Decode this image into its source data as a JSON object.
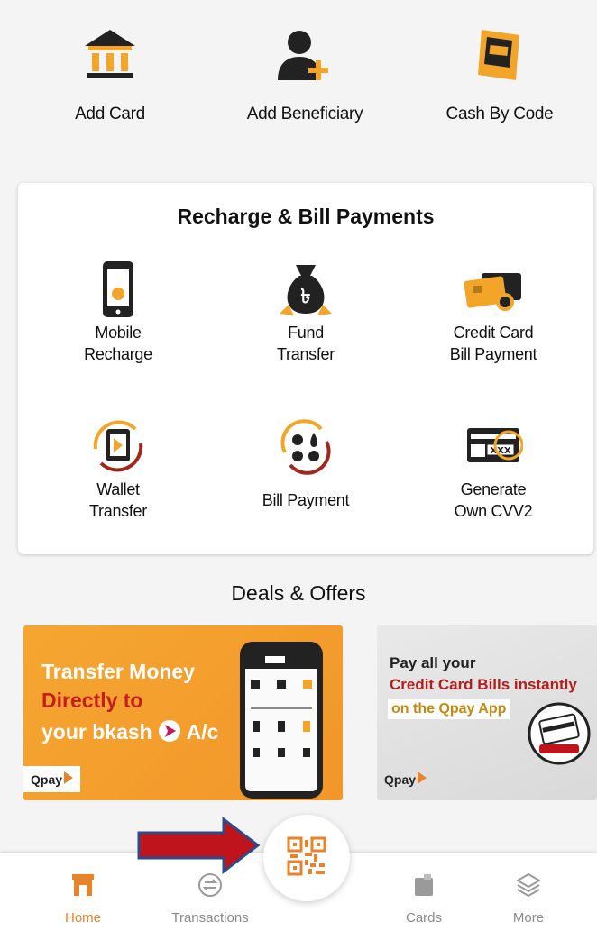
{
  "quick_actions": [
    {
      "label": "Add Card",
      "icon": "bank-icon"
    },
    {
      "label": "Add Beneficiary",
      "icon": "add-user-icon"
    },
    {
      "label": "Cash By Code",
      "icon": "atm-icon"
    }
  ],
  "recharge": {
    "title": "Recharge & Bill Payments",
    "items": [
      {
        "label": "Mobile\nRecharge",
        "icon": "mobile-icon"
      },
      {
        "label": "Fund\nTransfer",
        "icon": "money-bag-icon"
      },
      {
        "label": "Credit Card\nBill Payment",
        "icon": "credit-card-icon"
      },
      {
        "label": "Wallet\nTransfer",
        "icon": "wallet-transfer-icon"
      },
      {
        "label": "Bill Payment",
        "icon": "utility-icon"
      },
      {
        "label": "Generate\nOwn CVV2",
        "icon": "cvv-card-icon"
      }
    ]
  },
  "deals": {
    "title": "Deals & Offers",
    "banner1": {
      "line1": "Transfer Money",
      "line2": "Directly to",
      "line3_pre": "your bkash",
      "line3_post": "A/c",
      "brand": "Qpay"
    },
    "banner2": {
      "line1": "Pay all your",
      "line2": "Credit Card  Bills instantly",
      "line3": "on the Qpay App",
      "brand": "Qpay"
    }
  },
  "nav": {
    "home": "Home",
    "transactions": "Transactions",
    "cards": "Cards",
    "more": "More",
    "active": "Home"
  },
  "colors": {
    "accent": "#e7832a",
    "arrow": "#c0141c",
    "arrow_border": "#2d4a8a"
  }
}
